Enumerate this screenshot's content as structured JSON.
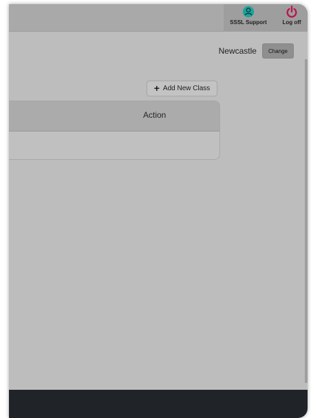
{
  "header": {
    "support_label": "SSSL Support",
    "logoff_label": "Log off",
    "support_icon": "user-circle-icon",
    "logoff_icon": "power-icon",
    "support_color": "#1ba39c",
    "logoff_color": "#b8174b"
  },
  "location": {
    "name": "Newcastle",
    "change_label": "Change"
  },
  "actions": {
    "add_class_label": "Add New Class"
  },
  "table": {
    "columns": [
      "Action"
    ],
    "rows": []
  }
}
